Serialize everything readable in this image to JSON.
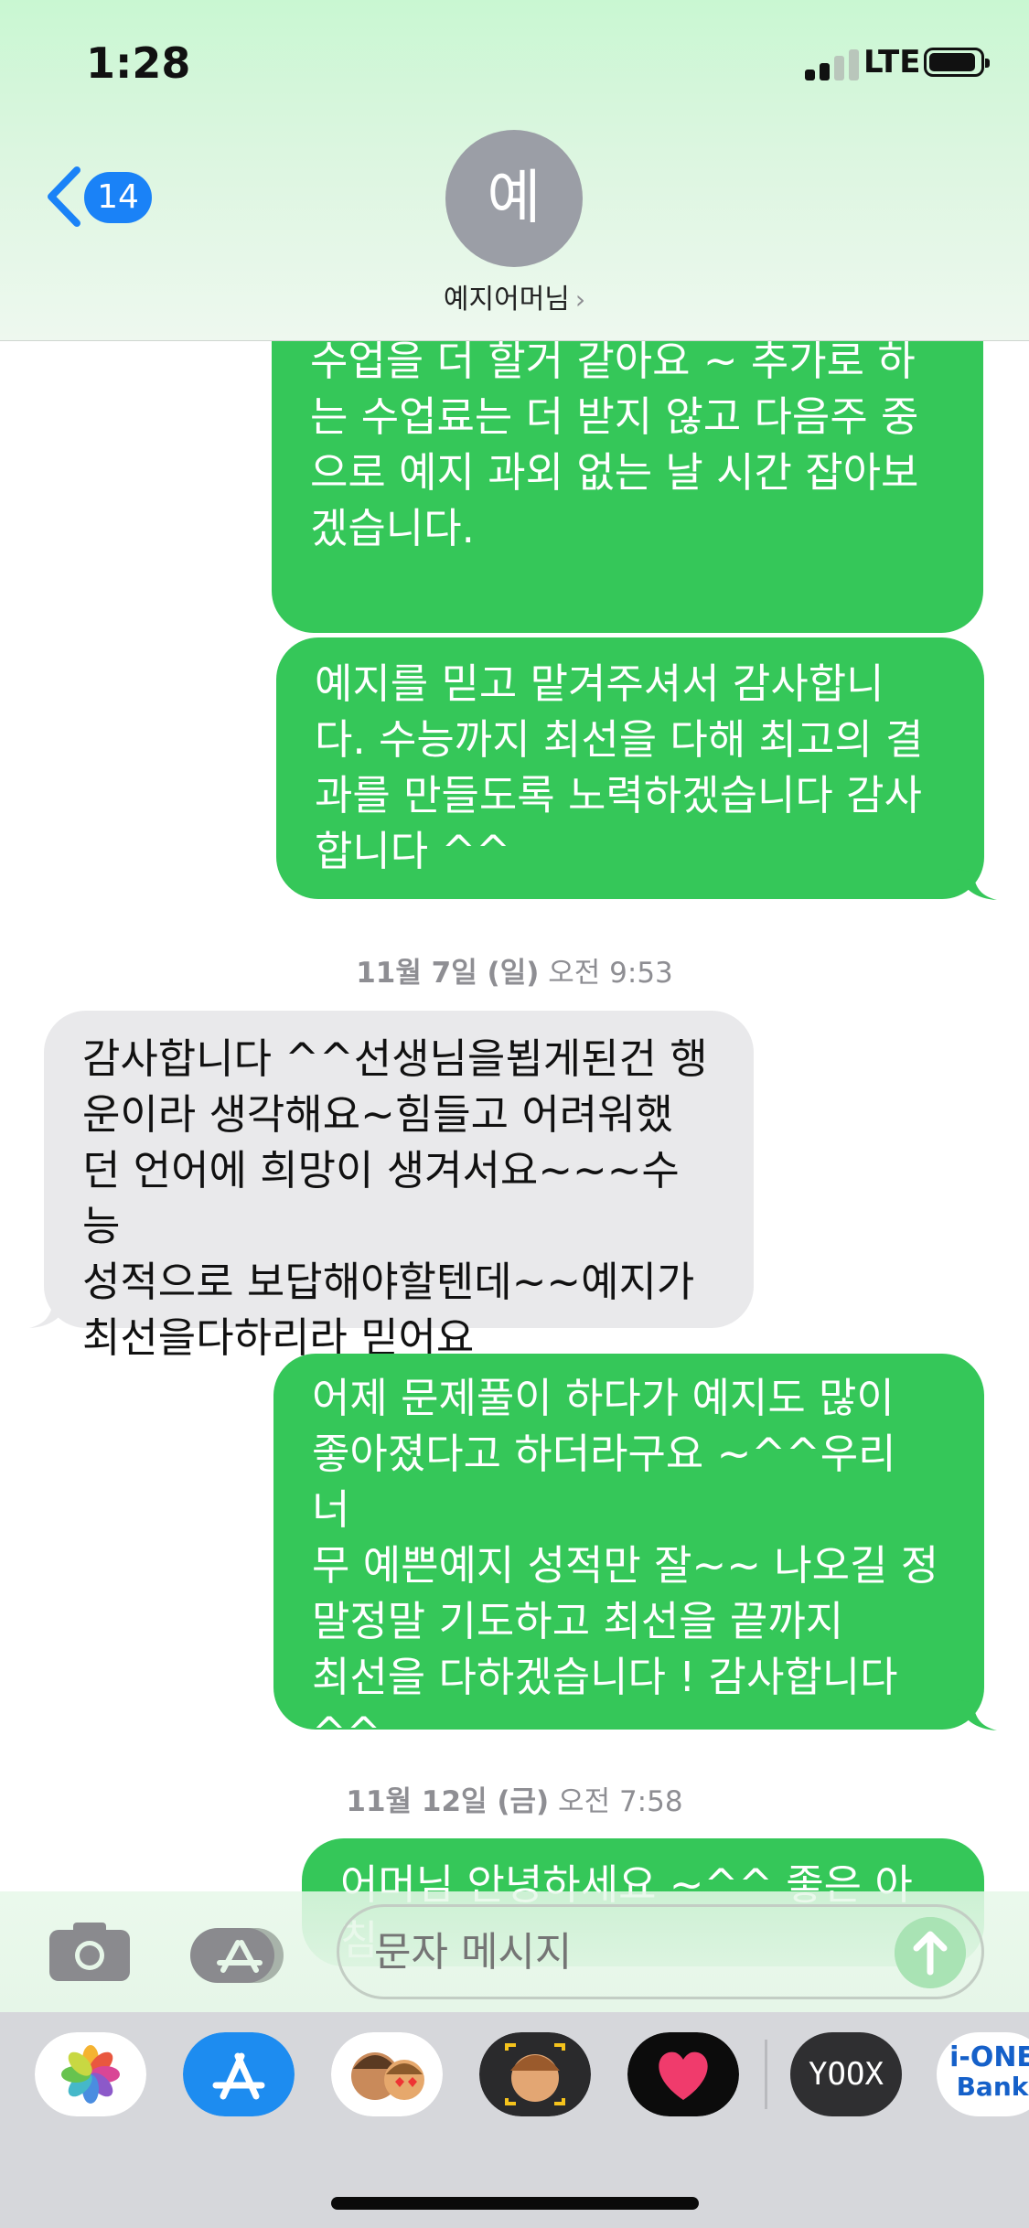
{
  "status_bar": {
    "time": "1:28",
    "network": "LTE"
  },
  "header": {
    "back_count": "14",
    "avatar_initial": "예",
    "contact_name": "예지어머님"
  },
  "messages": [
    {
      "type": "sent",
      "text": "수업을 더 할거 같아요 ~ 추가로 하\n는 수업료는 더 받지 않고 다음주 중\n으로 예지 과외 없는 날 시간 잡아보\n겠습니다."
    },
    {
      "type": "sent",
      "text": "예지를 믿고 맡겨주셔서 감사합니\n다. 수능까지 최선을 다해 최고의 결\n과를 만들도록 노력하겠습니다 감사\n합니다 ^^"
    },
    {
      "type": "timestamp",
      "date": "11월 7일 (일)",
      "time": "오전 9:53"
    },
    {
      "type": "received",
      "text": "감사합니다 ^^선생님을뵙게된건 행\n운이라 생각해요~힘들고 어려워했\n던 언어에 희망이 생겨서요~~~수능\n성적으로 보답해야할텐데~~예지가\n최선을다하리라 믿어요"
    },
    {
      "type": "sent",
      "text": "어제 문제풀이 하다가 예지도 많이\n좋아졌다고 하더라구요 ~^^우리 너\n무 예쁜예지 성적만 잘~~ 나오길 정\n말정말 기도하고 최선을 끝까지\n최선을 다하겠습니다 ! 감사합니다\n^^"
    },
    {
      "type": "timestamp",
      "date": "11월 12일 (금)",
      "time": "오전 7:58"
    },
    {
      "type": "sent",
      "text": "어머님 안녕하세요 ~^^ 좋은 아침"
    }
  ],
  "input": {
    "placeholder": "문자 메시지"
  },
  "app_tray": {
    "yoox_label": "YOOX",
    "ione_label_1": "i-ONE",
    "ione_label_2": "Bank"
  },
  "colors": {
    "sent_bubble": "#35c759",
    "received_bubble": "#e9e9eb",
    "accent_blue": "#1a82f7"
  }
}
